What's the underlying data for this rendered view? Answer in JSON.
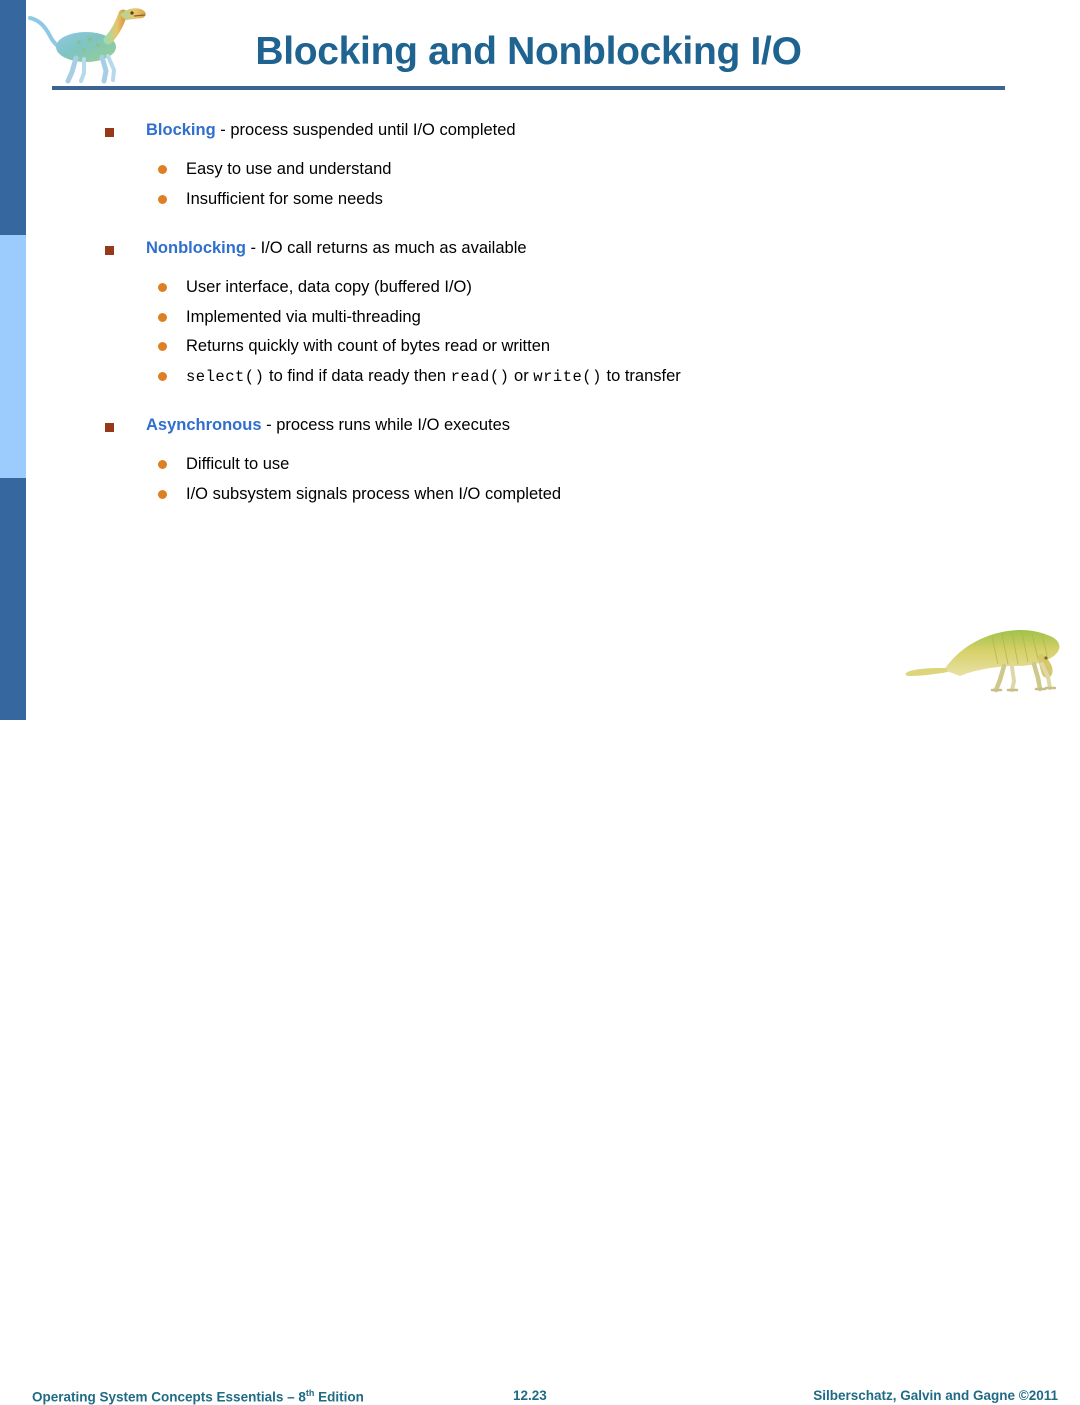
{
  "slide": {
    "title": "Blocking and Nonblocking I/O",
    "page_number": "12.23"
  },
  "colors": {
    "title": "#1F6391",
    "rule": "#3D6490",
    "sidebar_dark": "#36679E",
    "sidebar_light": "#9CCCFD",
    "square_bullet": "#96391A",
    "round_bullet": "#DD7F22",
    "keyword": "#2F6FCE",
    "footer": "#1F6B86"
  },
  "groups": [
    {
      "keyword": "Blocking",
      "heading_rest": " - process suspended until I/O completed",
      "sub": [
        {
          "parts": [
            {
              "t": "Easy to use and understand",
              "mono": false
            }
          ]
        },
        {
          "parts": [
            {
              "t": "Insufficient for some needs",
              "mono": false
            }
          ]
        }
      ]
    },
    {
      "keyword": "Nonblocking",
      "heading_rest": " - I/O call returns as much as available",
      "sub": [
        {
          "parts": [
            {
              "t": "User interface, data copy (buffered I/O)",
              "mono": false
            }
          ]
        },
        {
          "parts": [
            {
              "t": "Implemented via multi-threading",
              "mono": false
            }
          ]
        },
        {
          "parts": [
            {
              "t": "Returns quickly with count of bytes read or written",
              "mono": false
            }
          ]
        },
        {
          "parts": [
            {
              "t": "select()",
              "mono": true
            },
            {
              "t": " to find if data ready then ",
              "mono": false
            },
            {
              "t": "read()",
              "mono": true
            },
            {
              "t": " or ",
              "mono": false
            },
            {
              "t": "write()",
              "mono": true
            },
            {
              "t": " to transfer",
              "mono": false
            }
          ]
        }
      ]
    },
    {
      "keyword": "Asynchronous",
      "heading_rest": " - process runs while I/O executes",
      "sub": [
        {
          "parts": [
            {
              "t": "Difficult to use",
              "mono": false
            }
          ]
        },
        {
          "parts": [
            {
              "t": "I/O subsystem signals process when I/O completed",
              "mono": false
            }
          ]
        }
      ]
    }
  ],
  "footer": {
    "left_main": "Operating System Concepts Essentials – 8",
    "left_sup": "th",
    "left_tail": " Edition",
    "center": "12.23",
    "right": "Silberschatz, Galvin and Gagne ©2011"
  },
  "art": {
    "top_dinosaur": "ornithomimid-dinosaur-illustration",
    "bottom_dinosaur": "sail-backed-dinosaur-illustration"
  }
}
